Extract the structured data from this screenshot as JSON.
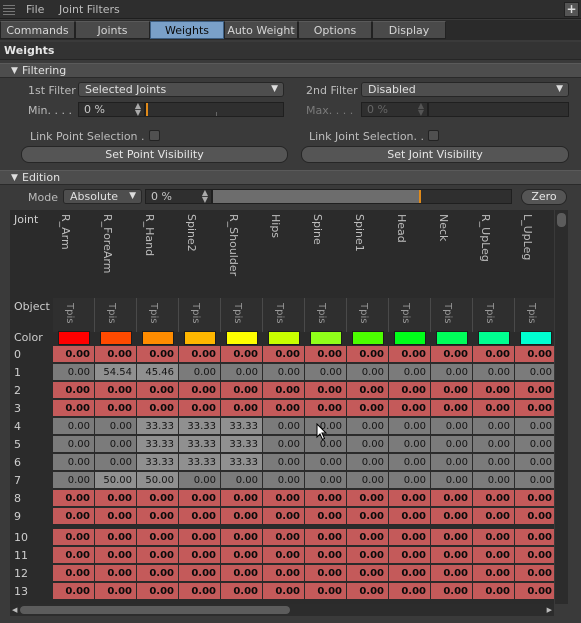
{
  "menubar": {
    "file": "File",
    "title": "Joint Filters",
    "expand": "+"
  },
  "tabs": [
    {
      "label": "Commands",
      "active": false
    },
    {
      "label": "Joints",
      "active": false
    },
    {
      "label": "Weights",
      "active": true
    },
    {
      "label": "Auto Weight",
      "active": false
    },
    {
      "label": "Options",
      "active": false
    },
    {
      "label": "Display",
      "active": false
    }
  ],
  "section_title": "Weights",
  "filtering": {
    "title": "Filtering",
    "filter1_label": "1st Filter",
    "filter1_value": "Selected Joints",
    "filter2_label": "2nd Filter",
    "filter2_value": "Disabled",
    "min_label": "Min. . . .",
    "min_value": "0 %",
    "max_label": "Max. . . .",
    "max_value": "0 %",
    "link_point": "Link Point Selection . .",
    "link_joint": "Link Joint Selection. . .",
    "set_point": "Set Point Visibility",
    "set_joint": "Set Joint Visibility"
  },
  "edition": {
    "title": "Edition",
    "mode_label": "Mode",
    "mode_value": "Absolute",
    "strength_value": "0 %",
    "strength_fraction": 0.69,
    "zero_button": "Zero"
  },
  "table": {
    "joint_header": "Joint",
    "object_header": "Object",
    "color_header": "Color",
    "joints": [
      "R_Arm",
      "R_ForeArm",
      "R_Hand",
      "Spine2",
      "R_Shoulder",
      "Hips",
      "Spine",
      "Spine1",
      "Head",
      "Neck",
      "R_UpLeg",
      "L_UpLeg"
    ],
    "object_label": "Tpis",
    "colors": [
      "#ff0000",
      "#ff4a00",
      "#ff8c00",
      "#ffb700",
      "#ffff00",
      "#c8ff00",
      "#90ff1a",
      "#4cff00",
      "#00ff1a",
      "#00ff5a",
      "#00ff90",
      "#00ffd0"
    ],
    "rows": [
      {
        "id": "0",
        "style": "r",
        "values": [
          "0.00",
          "0.00",
          "0.00",
          "0.00",
          "0.00",
          "0.00",
          "0.00",
          "0.00",
          "0.00",
          "0.00",
          "0.00",
          "0.00"
        ]
      },
      {
        "id": "1",
        "style": "g",
        "values": [
          "0.00",
          "54.54",
          "45.46",
          "0.00",
          "0.00",
          "0.00",
          "0.00",
          "0.00",
          "0.00",
          "0.00",
          "0.00",
          "0.00"
        ]
      },
      {
        "id": "2",
        "style": "r",
        "values": [
          "0.00",
          "0.00",
          "0.00",
          "0.00",
          "0.00",
          "0.00",
          "0.00",
          "0.00",
          "0.00",
          "0.00",
          "0.00",
          "0.00"
        ]
      },
      {
        "id": "3",
        "style": "r",
        "values": [
          "0.00",
          "0.00",
          "0.00",
          "0.00",
          "0.00",
          "0.00",
          "0.00",
          "0.00",
          "0.00",
          "0.00",
          "0.00",
          "0.00"
        ]
      },
      {
        "id": "4",
        "style": "g",
        "values": [
          "0.00",
          "0.00",
          "33.33",
          "33.33",
          "33.33",
          "0.00",
          "0.00",
          "0.00",
          "0.00",
          "0.00",
          "0.00",
          "0.00"
        ]
      },
      {
        "id": "5",
        "style": "g",
        "values": [
          "0.00",
          "0.00",
          "33.33",
          "33.33",
          "33.33",
          "0.00",
          "0.00",
          "0.00",
          "0.00",
          "0.00",
          "0.00",
          "0.00"
        ]
      },
      {
        "id": "6",
        "style": "g",
        "values": [
          "0.00",
          "0.00",
          "33.33",
          "33.33",
          "33.33",
          "0.00",
          "0.00",
          "0.00",
          "0.00",
          "0.00",
          "0.00",
          "0.00"
        ]
      },
      {
        "id": "7",
        "style": "g",
        "values": [
          "0.00",
          "50.00",
          "50.00",
          "0.00",
          "0.00",
          "0.00",
          "0.00",
          "0.00",
          "0.00",
          "0.00",
          "0.00",
          "0.00"
        ]
      },
      {
        "id": "8",
        "style": "r",
        "values": [
          "0.00",
          "0.00",
          "0.00",
          "0.00",
          "0.00",
          "0.00",
          "0.00",
          "0.00",
          "0.00",
          "0.00",
          "0.00",
          "0.00"
        ]
      },
      {
        "id": "9",
        "style": "r",
        "values": [
          "0.00",
          "0.00",
          "0.00",
          "0.00",
          "0.00",
          "0.00",
          "0.00",
          "0.00",
          "0.00",
          "0.00",
          "0.00",
          "0.00"
        ]
      },
      {
        "id": "10",
        "style": "r",
        "values": [
          "0.00",
          "0.00",
          "0.00",
          "0.00",
          "0.00",
          "0.00",
          "0.00",
          "0.00",
          "0.00",
          "0.00",
          "0.00",
          "0.00"
        ]
      },
      {
        "id": "11",
        "style": "r",
        "values": [
          "0.00",
          "0.00",
          "0.00",
          "0.00",
          "0.00",
          "0.00",
          "0.00",
          "0.00",
          "0.00",
          "0.00",
          "0.00",
          "0.00"
        ]
      },
      {
        "id": "12",
        "style": "r",
        "values": [
          "0.00",
          "0.00",
          "0.00",
          "0.00",
          "0.00",
          "0.00",
          "0.00",
          "0.00",
          "0.00",
          "0.00",
          "0.00",
          "0.00"
        ]
      },
      {
        "id": "13",
        "style": "r",
        "values": [
          "0.00",
          "0.00",
          "0.00",
          "0.00",
          "0.00",
          "0.00",
          "0.00",
          "0.00",
          "0.00",
          "0.00",
          "0.00",
          "0.00"
        ]
      }
    ]
  }
}
